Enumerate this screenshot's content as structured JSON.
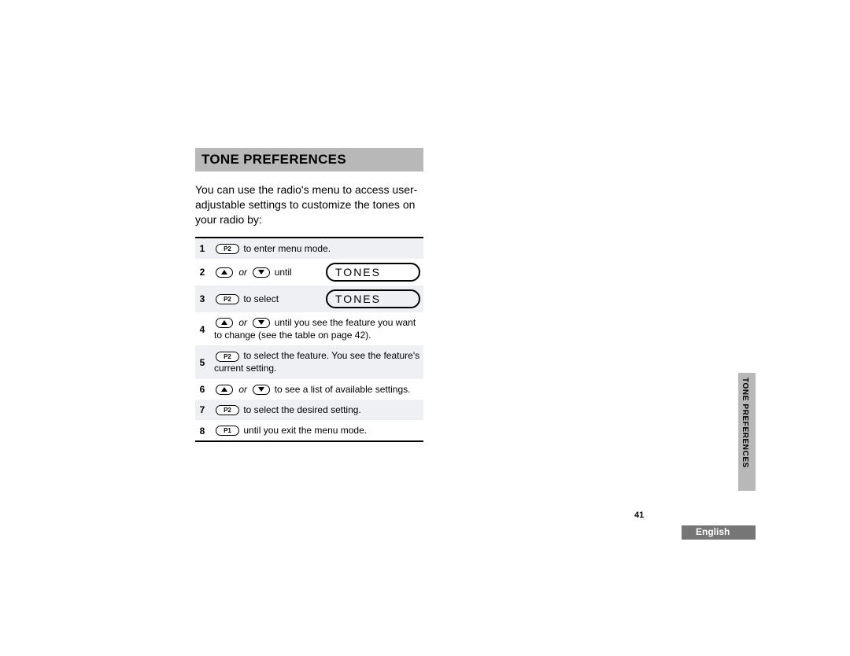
{
  "heading": "TONE PREFERENCES",
  "intro": "You can use the radio's menu to access user-adjustable settings to customize the tones on your radio by:",
  "buttons": {
    "p1": "P1",
    "p2": "P2",
    "or": "or",
    "until": "until"
  },
  "display_text": "TONES",
  "steps": [
    {
      "n": "1",
      "text_after": "to enter menu mode.",
      "pre": "p2",
      "display": false,
      "alt": true
    },
    {
      "n": "2",
      "text_after": " ",
      "pre": "updown_until",
      "display": true,
      "alt": false
    },
    {
      "n": "3",
      "text_after": "to select",
      "pre": "p2",
      "display": true,
      "alt": true
    },
    {
      "n": "4",
      "text_after": "until you see the feature you want to change (see the table on page 42).",
      "pre": "updown",
      "display": false,
      "alt": false
    },
    {
      "n": "5",
      "text_after": "to select the feature. You see the feature's current setting.",
      "pre": "p2",
      "display": false,
      "alt": true
    },
    {
      "n": "6",
      "text_after": "to see a list of available settings.",
      "pre": "updown",
      "display": false,
      "alt": false
    },
    {
      "n": "7",
      "text_after": "to select the desired setting.",
      "pre": "p2",
      "display": false,
      "alt": true
    },
    {
      "n": "8",
      "text_after": "until you exit the menu mode.",
      "pre": "p1",
      "display": false,
      "alt": false
    }
  ],
  "side_tab": "TONE PREFERENCES",
  "page_number": "41",
  "language": "English"
}
